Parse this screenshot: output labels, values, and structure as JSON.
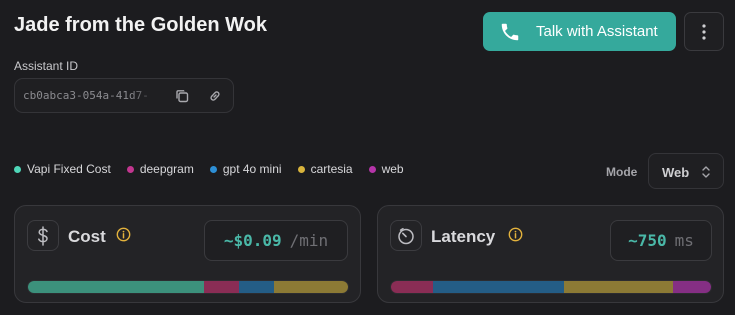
{
  "header": {
    "title": "Jade from the Golden Wok",
    "talk_button_label": "Talk with Assistant",
    "talk_button_color": "#35a99c"
  },
  "assistant_id": {
    "label": "Assistant ID",
    "value": "cb0abca3-054a-41d7-"
  },
  "legend": [
    {
      "label": "Vapi Fixed Cost",
      "color": "#4fd6b8"
    },
    {
      "label": "deepgram",
      "color": "#c2368f"
    },
    {
      "label": "gpt 4o mini",
      "color": "#2d8fd6"
    },
    {
      "label": "cartesia",
      "color": "#d9b43c"
    },
    {
      "label": "web",
      "color": "#b534a8"
    }
  ],
  "mode": {
    "label": "Mode",
    "value": "Web"
  },
  "cost": {
    "title": "Cost",
    "value": "~$0.09",
    "unit": "/min",
    "breakdown_fractions": [
      {
        "source": "Vapi Fixed Cost",
        "fraction": 0.55,
        "color": "#3c917c"
      },
      {
        "source": "deepgram",
        "fraction": 0.11,
        "color": "#8a2d55"
      },
      {
        "source": "gpt 4o mini",
        "fraction": 0.11,
        "color": "#245d86"
      },
      {
        "source": "cartesia",
        "fraction": 0.23,
        "color": "#8c7a35"
      }
    ]
  },
  "latency": {
    "title": "Latency",
    "value": "~750",
    "unit": "ms",
    "breakdown_fractions": [
      {
        "source": "deepgram",
        "fraction": 0.13,
        "color": "#8a2d55"
      },
      {
        "source": "gpt 4o mini",
        "fraction": 0.41,
        "color": "#245d86"
      },
      {
        "source": "cartesia",
        "fraction": 0.34,
        "color": "#8c7a35"
      },
      {
        "source": "web",
        "fraction": 0.12,
        "color": "#852f84"
      }
    ]
  }
}
